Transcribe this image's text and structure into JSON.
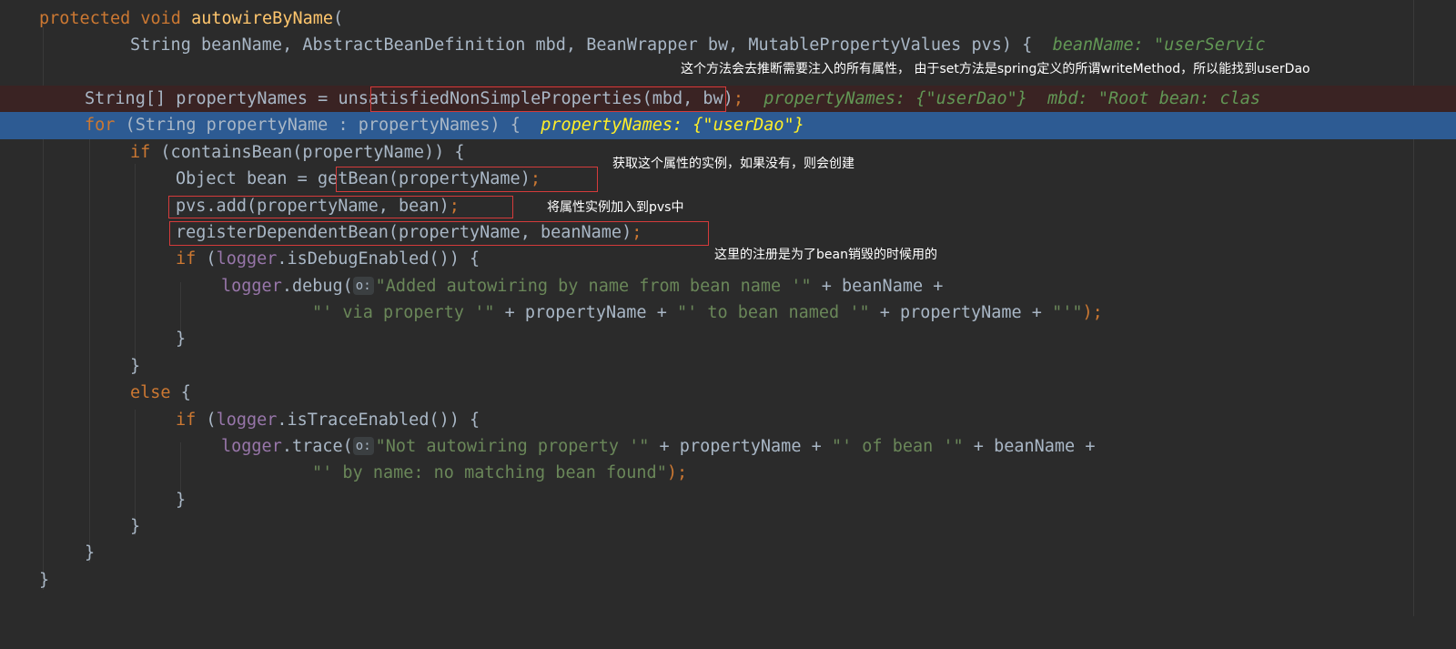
{
  "code": {
    "l1": {
      "kw": "protected void ",
      "fn": "autowireByName",
      "rest": "("
    },
    "l2": {
      "text": "String beanName, AbstractBeanDefinition mbd, BeanWrapper bw, MutablePropertyValues pvs) ",
      "brace": "{",
      "inline": "beanName: \"userServic"
    },
    "l3": {
      "pre": "String[] propertyNames = ",
      "call": "unsatisfiedNonSimpleProperties",
      "args": "(mbd, bw)",
      "semi": ";",
      "inline": "propertyNames: {\"userDao\"}  mbd: \"Root bean: clas"
    },
    "l4": {
      "kw": "for",
      "text": " (String propertyName : propertyNames) {  ",
      "inline": "propertyNames: {\"userDao\"}"
    },
    "l5": {
      "kw": "if",
      "text": " (containsBean(propertyName)) {"
    },
    "l6": {
      "pre": "Object bean = ",
      "call": "getBean(propertyName)",
      "semi": ";"
    },
    "l7": {
      "call": "pvs.add(propertyName, bean)",
      "semi": ";"
    },
    "l8": {
      "call": "registerDependentBean(propertyName, beanName)",
      "semi": ";"
    },
    "l9": {
      "kw": "if",
      "pre": " (",
      "field": "logger",
      "rest": ".isDebugEnabled()) {"
    },
    "l10": {
      "field": "logger",
      "call": ".debug(",
      "hint": "o:",
      "str": "\"Added autowiring by name from bean name '\"",
      "rest": " + beanName +"
    },
    "l11": {
      "str1": "\"' via property '\"",
      "mid1": " + propertyName + ",
      "str2": "\"' to bean named '\"",
      "mid2": " + propertyName + ",
      "str3": "\"'\"",
      "end": ");"
    },
    "l12": {
      "text": "}"
    },
    "l13": {
      "text": "}"
    },
    "l14": {
      "kw": "else",
      "text": " {"
    },
    "l15": {
      "kw": "if",
      "pre": " (",
      "field": "logger",
      "rest": ".isTraceEnabled()) {"
    },
    "l16": {
      "field": "logger",
      "call": ".trace(",
      "hint": "o:",
      "str1": "\"Not autowiring property '\"",
      "mid1": " + propertyName + ",
      "str2": "\"' of bean '\"",
      "rest": " + beanName +"
    },
    "l17": {
      "str": "\"' by name: no matching bean found\"",
      "end": ");"
    },
    "l18": {
      "text": "}"
    },
    "l19": {
      "text": "}"
    },
    "l20": {
      "text": "}"
    },
    "l21": {
      "text": "}"
    }
  },
  "notes": {
    "n1": "这个方法会去推断需要注入的所有属性， 由于set方法是spring定义的所谓writeMethod，所以能找到userDao",
    "n2": "获取这个属性的实例，如果没有，则会创建",
    "n3": "将属性实例加入到pvs中",
    "n4": "这里的注册是为了bean销毁的时候用的"
  },
  "colors": {
    "background": "#2b2b2b",
    "keyword": "#cc7832",
    "method": "#ffc66d",
    "field": "#9876aa",
    "string": "#6a8759",
    "execution_line": "#2d5b93",
    "annotation_box": "#d43b3b"
  }
}
